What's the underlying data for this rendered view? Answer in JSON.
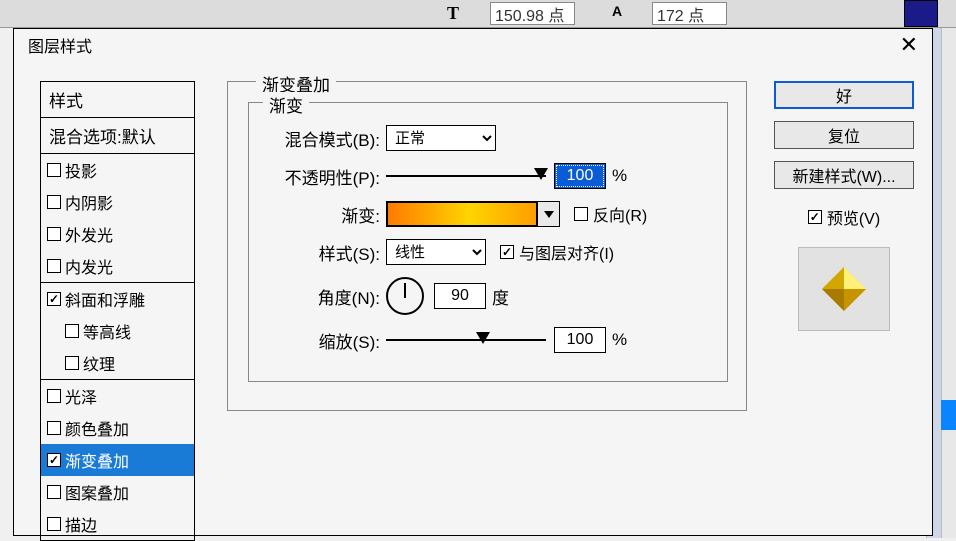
{
  "bg": {
    "font_size": "150.98 点",
    "leading": "172 点"
  },
  "dialog": {
    "title": "图层样式",
    "styles_header": "样式",
    "blend_header": "混合选项:默认",
    "styles": [
      {
        "label": "投影",
        "checked": false
      },
      {
        "label": "内阴影",
        "checked": false
      },
      {
        "label": "外发光",
        "checked": false
      },
      {
        "label": "内发光",
        "checked": false
      },
      {
        "label": "斜面和浮雕",
        "checked": true
      },
      {
        "label": "等高线",
        "checked": false,
        "sub": true
      },
      {
        "label": "纹理",
        "checked": false,
        "sub": true
      },
      {
        "label": "光泽",
        "checked": false
      },
      {
        "label": "颜色叠加",
        "checked": false
      },
      {
        "label": "渐变叠加",
        "checked": true,
        "selected": true
      },
      {
        "label": "图案叠加",
        "checked": false
      },
      {
        "label": "描边",
        "checked": false
      }
    ],
    "group_title": "渐变叠加",
    "inner_title": "渐变",
    "blend_mode": {
      "label": "混合模式(B):",
      "value": "正常"
    },
    "opacity": {
      "label": "不透明性(P):",
      "value": "100",
      "unit": "%"
    },
    "gradient": {
      "label": "渐变:",
      "reverse_label": "反向(R)",
      "reverse": false
    },
    "style": {
      "label": "样式(S):",
      "value": "线性",
      "align_label": "与图层对齐(I)",
      "align": true
    },
    "angle": {
      "label": "角度(N):",
      "value": "90",
      "unit": "度"
    },
    "scale": {
      "label": "缩放(S):",
      "value": "100",
      "unit": "%"
    },
    "buttons": {
      "ok": "好",
      "reset": "复位",
      "newstyle": "新建样式(W)..."
    },
    "preview": {
      "label": "预览(V)",
      "checked": true
    }
  }
}
